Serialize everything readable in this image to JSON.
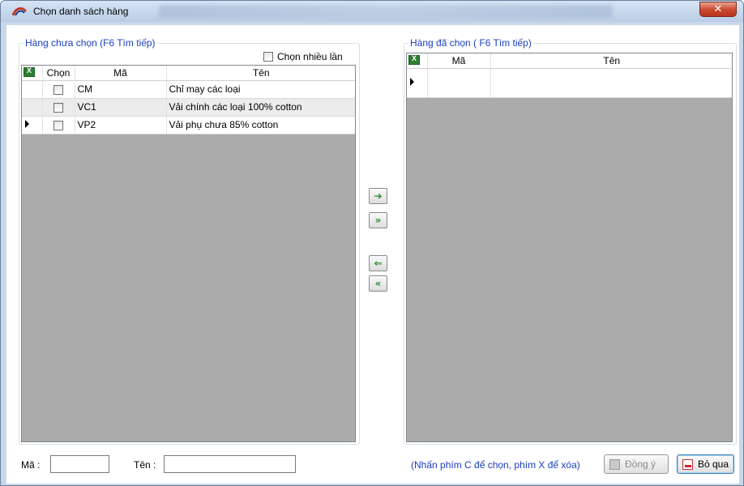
{
  "window": {
    "title": "Chọn danh sách hàng",
    "close_label": "✕"
  },
  "left_panel": {
    "title": "Hàng chưa chọn (F6 Tìm tiếp)",
    "multi_select_label": "Chọn nhiều lần",
    "columns": [
      "Chọn",
      "Mã",
      "Tên"
    ],
    "rows": [
      {
        "code": "CM",
        "name": "Chỉ may các loại",
        "checked": false
      },
      {
        "code": "VC1",
        "name": "Vải chính các loại 100% cotton",
        "checked": false
      },
      {
        "code": "VP2",
        "name": "Vải phụ chưa 85% cotton",
        "checked": false
      }
    ]
  },
  "right_panel": {
    "title": "Hàng đã chọn ( F6 Tìm tiếp)",
    "columns": [
      "Mã",
      "Tên"
    ]
  },
  "transfer": {
    "add_one": "➔",
    "add_all": "»",
    "remove_one": "⇐",
    "remove_all": "«"
  },
  "bottom": {
    "ma_label": "Mã :",
    "ten_label": "Tên :",
    "ma_value": "",
    "ten_value": "",
    "hint": "(Nhấn phím C để chọn, phím X để xóa)",
    "ok_label": "Đồng ý",
    "cancel_label": "Bỏ qua"
  },
  "colors": {
    "accent_blue": "#1a3fbf",
    "close_red": "#c9462c"
  }
}
